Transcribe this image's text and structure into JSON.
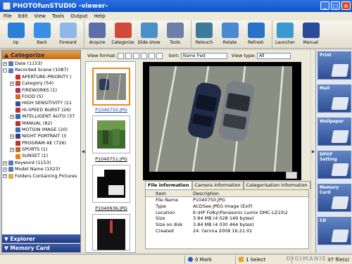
{
  "window": {
    "title": "PHOTOfunSTUDIO -viewer-"
  },
  "menu": [
    "File",
    "Edit",
    "View",
    "Tools",
    "Output",
    "Help"
  ],
  "toolbar": [
    {
      "label": "Up",
      "icon": "up-folder-icon",
      "color": "#2b7fd6"
    },
    {
      "label": "Back",
      "icon": "back-arrow-icon",
      "color": "#3a8ee8"
    },
    {
      "label": "Forward",
      "icon": "forward-arrow-icon",
      "color": "#8fb8e8"
    },
    {
      "label": "Acquire",
      "icon": "acquire-icon",
      "color": "#5b6fa8"
    },
    {
      "label": "Categorize",
      "icon": "categorize-icon",
      "color": "#d04a3a"
    },
    {
      "label": "Slide show",
      "icon": "slideshow-icon",
      "color": "#4a90c8"
    },
    {
      "label": "Tools",
      "icon": "tools-icon",
      "color": "#6b7fa8"
    },
    {
      "label": "Retouch",
      "icon": "retouch-icon",
      "color": "#3b7a9a"
    },
    {
      "label": "Rotate",
      "icon": "rotate-icon",
      "color": "#4a8ad0"
    },
    {
      "label": "Refresh",
      "icon": "refresh-icon",
      "color": "#2a72c8"
    },
    {
      "label": "Launcher",
      "icon": "launcher-icon",
      "color": "#3a9ad0"
    },
    {
      "label": "Manual",
      "icon": "manual-icon",
      "color": "#2a4a9a"
    }
  ],
  "sidebar": {
    "header": "Categorize",
    "tree": [
      {
        "label": "Date (1153)",
        "indent": 0,
        "expander": "+",
        "color": "#5a7ab8"
      },
      {
        "label": "Recorded Scene (1087)",
        "indent": 0,
        "expander": "−",
        "color": "#5a7ab8"
      },
      {
        "label": "APERTURE-PRIORITY (",
        "indent": 1,
        "expander": "",
        "color": "#c23030"
      },
      {
        "label": "Category  (54)",
        "indent": 1,
        "expander": "+",
        "color": "#d04a3a"
      },
      {
        "label": "FIREWORKS (1)",
        "indent": 1,
        "expander": "",
        "color": "#b03060"
      },
      {
        "label": "FOOD (5)",
        "indent": 1,
        "expander": "",
        "color": "#c87020"
      },
      {
        "label": "HIGH SENSITIVITY (11",
        "indent": 1,
        "expander": "",
        "color": "#3050a0"
      },
      {
        "label": "HI-SPEED BURST (26)",
        "indent": 1,
        "expander": "",
        "color": "#c03030"
      },
      {
        "label": "INTELLIGENT AUTO (37",
        "indent": 1,
        "expander": "+",
        "color": "#2a6ab0"
      },
      {
        "label": "MANUAL (82)",
        "indent": 1,
        "expander": "",
        "color": "#c03030"
      },
      {
        "label": "MOTION IMAGE (20)",
        "indent": 1,
        "expander": "",
        "color": "#3a70b8"
      },
      {
        "label": "NIGHT PORTRAIT (3",
        "indent": 1,
        "expander": "+",
        "color": "#304080"
      },
      {
        "label": "PROGRAM AE (726)",
        "indent": 1,
        "expander": "",
        "color": "#c03030"
      },
      {
        "label": "SPORTS (1)",
        "indent": 1,
        "expander": "+",
        "color": "#d06020"
      },
      {
        "label": "SUNSET (1)",
        "indent": 1,
        "expander": "",
        "color": "#e08020"
      },
      {
        "label": "Keyword (1153)",
        "indent": 0,
        "expander": "+",
        "color": "#5a7ab8"
      },
      {
        "label": "Model Name (1023)",
        "indent": 0,
        "expander": "+",
        "color": "#5a7ab8"
      },
      {
        "label": "Folders Containing Pictures",
        "indent": 0,
        "expander": "+",
        "color": "#d8b040"
      }
    ],
    "footer_items": [
      "Explorer",
      "Memory Card"
    ]
  },
  "viewbar": {
    "view_format_label": "View format:",
    "sort_label": "Sort:",
    "sort_value": "Name Fwd",
    "view_type_label": "View type:",
    "view_type_value": "All"
  },
  "thumbnails": [
    {
      "caption": "P1040750.JPG",
      "active": true
    },
    {
      "caption": "P1040751.JPG",
      "active": false
    },
    {
      "caption": "P1040936.JPG",
      "active": false
    },
    {
      "caption": "",
      "active": false
    }
  ],
  "info": {
    "tabs": [
      "File information",
      "Camera information",
      "Categorisation information",
      "C"
    ],
    "active_tab": 0,
    "headers": {
      "item": "Item",
      "description": "Description"
    },
    "rows": [
      {
        "item": "File Name",
        "description": "P1040750.JPG"
      },
      {
        "item": "Type",
        "description": "ACDSee JPEG Image (Exif)"
      },
      {
        "item": "Location",
        "description": "K:\\HP Folky\\Panasonic Lumix DMC-LZ10\\2"
      },
      {
        "item": "Size",
        "description": "3.84 MB (4 028 149 bytes)"
      },
      {
        "item": "Size on disk",
        "description": "3.84 MB (4 030 464 bytes)"
      },
      {
        "item": "Created",
        "description": "24. června 2008 16:21:01"
      }
    ]
  },
  "right_panel": [
    "Print",
    "Mail",
    "Wallpaper",
    "DPOF Setting",
    "Memory Card",
    "CD"
  ],
  "status": {
    "mark": "0 Mark",
    "select": "1 Select",
    "files": "37 file(s)",
    "logo": "DIGIMANIE"
  }
}
